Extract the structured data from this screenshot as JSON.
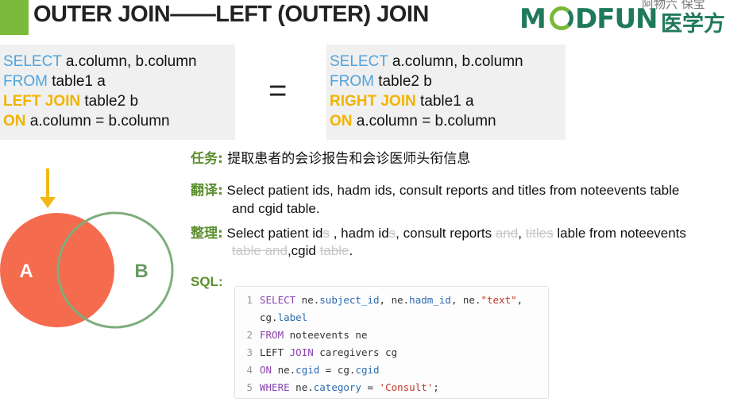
{
  "header": {
    "title": "OUTER JOIN——LEFT (OUTER) JOIN",
    "accent": "#7cba3b"
  },
  "logo": {
    "letter_m": "M",
    "letters": "DFUN",
    "chinese": "医学方",
    "overlay": "阿物六 保宝"
  },
  "left_query": {
    "line1": {
      "kw": "SELECT",
      "rest": " a.column, b.column"
    },
    "line2": {
      "kw": "FROM",
      "rest": " table1 a"
    },
    "line3": {
      "kw": "LEFT JOIN",
      "rest": " table2 b"
    },
    "line4": {
      "kw": "ON",
      "rest": " a.column = b.column"
    }
  },
  "equals_sign": "=",
  "right_query": {
    "line1": {
      "kw": "SELECT",
      "rest": " a.column, b.column"
    },
    "line2": {
      "kw": "FROM",
      "rest": " table2 b"
    },
    "line3": {
      "kw": "RIGHT JOIN",
      "rest": " table1 a"
    },
    "line4": {
      "kw": "ON",
      "rest": " a.column = b.column"
    }
  },
  "venn": {
    "label_a": "A",
    "label_b": "B",
    "color_a": "#f56b4e",
    "color_b": "#7fae7c",
    "arrow_color": "#f3b814"
  },
  "task": {
    "label": "任务:",
    "text": " 提取患者的会诊报告和会诊医师头衔信息"
  },
  "translation": {
    "label": "翻译:",
    "line1": " Select patient ids, hadm ids, consult reports and titles from noteevents table",
    "line2": "and cgid table."
  },
  "organize": {
    "label": "整理:",
    "seg1": " Select patient id",
    "seg1_struck": "s",
    "seg2": " , hadm id",
    "seg2_struck": "s",
    "seg3": ", consult reports ",
    "seg3_struck": "and",
    "seg4": ", ",
    "seg4_struck": "titles",
    "seg5": " lable from noteevents",
    "line2_struck1": "table and",
    "line2_seg": ",cgid ",
    "line2_struck2": "table",
    "line2_end": "."
  },
  "sql": {
    "label": "SQL:",
    "lines": {
      "n1": "1",
      "n1b": "",
      "n2": "2",
      "n3": "3",
      "n4": "4",
      "n5": "5",
      "l1_kw": "SELECT",
      "l1_a": " ne.",
      "l1_f1": "subject_id",
      "l1_b": ", ne.",
      "l1_f2": "hadm_id",
      "l1_c": ", ne.",
      "l1_s": "\"text\"",
      "l1_d": ",",
      "l1b_a": "cg.",
      "l1b_f": "label",
      "l2_kw": "FROM",
      "l2_rest": " noteevents ne",
      "l3_kw1": "LEFT",
      "l3_kw2": " JOIN",
      "l3_rest": " caregivers cg",
      "l4_kw": "ON",
      "l4_a": " ne.",
      "l4_f1": "cgid",
      "l4_b": " = cg.",
      "l4_f2": "cgid",
      "l5_kw": "WHERE",
      "l5_a": " ne.",
      "l5_f": "category",
      "l5_b": " = ",
      "l5_s": "'Consult'",
      "l5_c": ";"
    }
  }
}
